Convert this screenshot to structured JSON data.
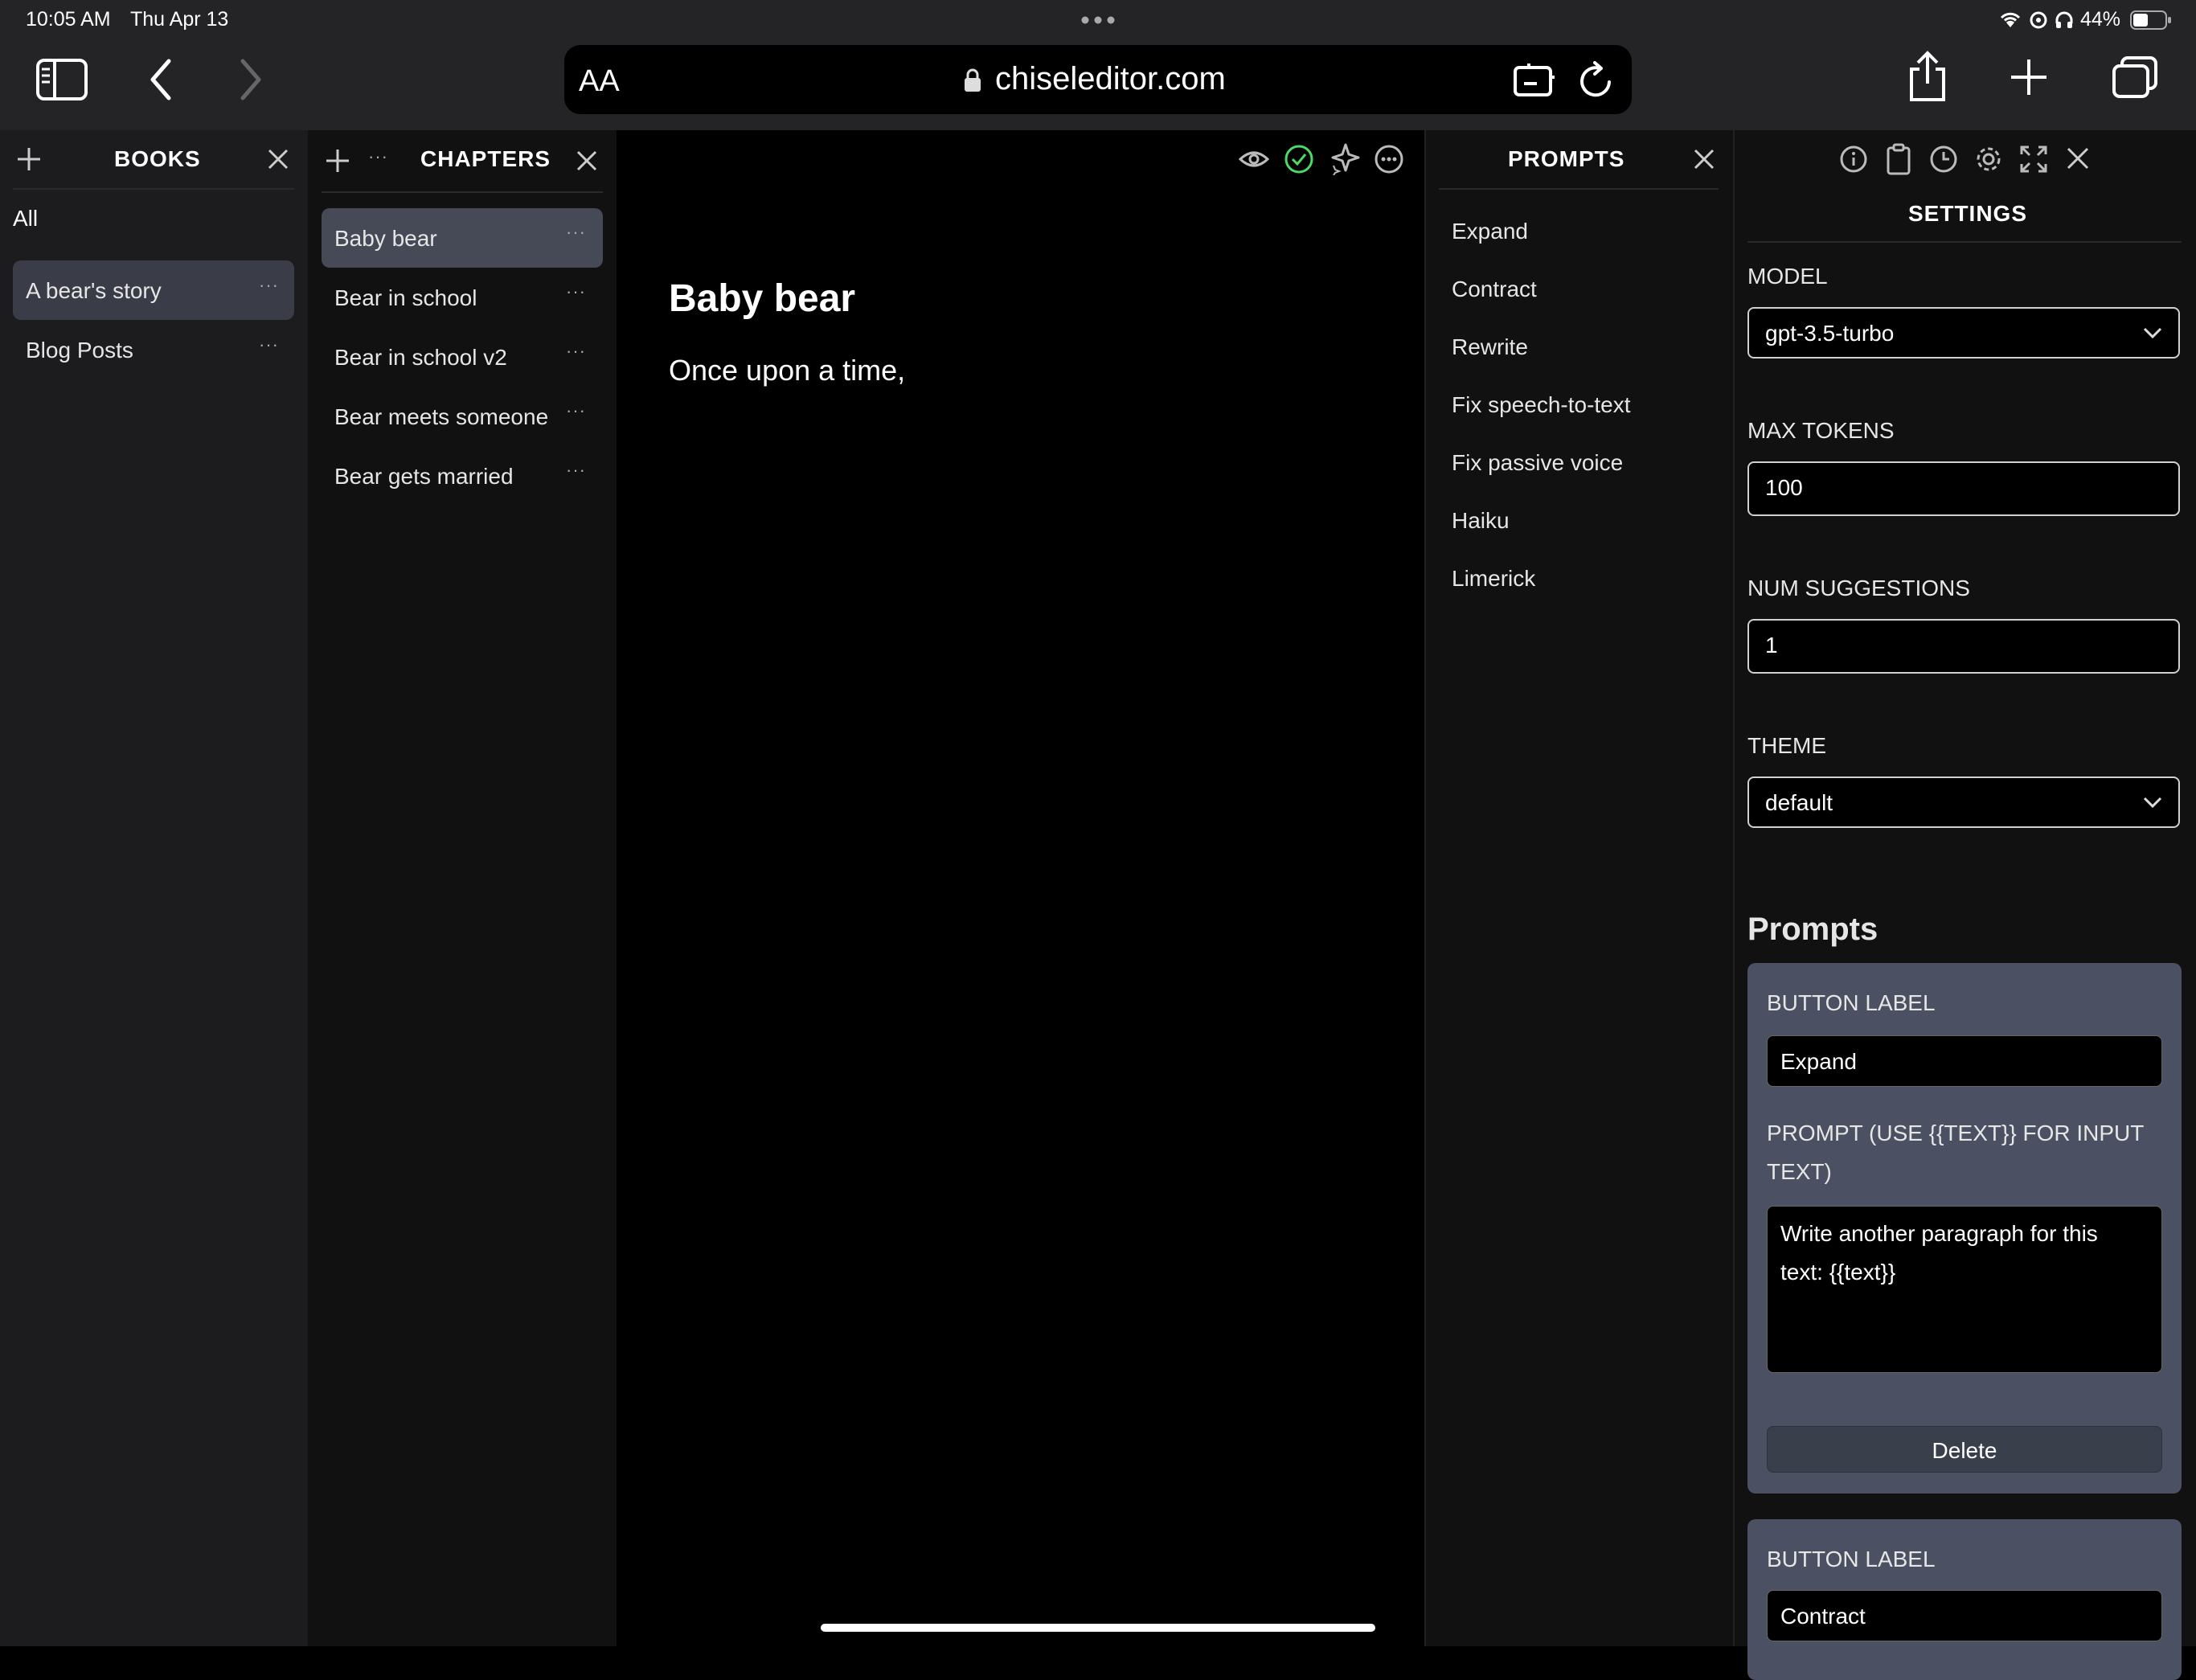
{
  "status": {
    "time": "10:05 AM",
    "date": "Thu Apr 13",
    "battery": "44%"
  },
  "browser": {
    "aa": "AA",
    "url": "chiseleditor.com"
  },
  "books": {
    "title": "BOOKS",
    "all_label": "All",
    "items": [
      {
        "label": "A bear's story",
        "selected": true
      },
      {
        "label": "Blog Posts",
        "selected": false
      }
    ]
  },
  "chapters": {
    "title": "CHAPTERS",
    "items": [
      {
        "label": "Baby bear",
        "selected": true
      },
      {
        "label": "Bear in school"
      },
      {
        "label": "Bear in school v2"
      },
      {
        "label": "Bear meets someone"
      },
      {
        "label": "Bear gets married"
      }
    ]
  },
  "editor": {
    "title": "Baby bear",
    "body": "Once upon a time,"
  },
  "prompts_panel": {
    "title": "PROMPTS",
    "items": [
      "Expand",
      "Contract",
      "Rewrite",
      "Fix speech-to-text",
      "Fix passive voice",
      "Haiku",
      "Limerick"
    ]
  },
  "settings": {
    "title": "SETTINGS",
    "model_label": "MODEL",
    "model_value": "gpt-3.5-turbo",
    "max_tokens_label": "MAX TOKENS",
    "max_tokens_value": "100",
    "num_suggestions_label": "NUM SUGGESTIONS",
    "num_suggestions_value": "1",
    "theme_label": "THEME",
    "theme_value": "default",
    "prompts_heading": "Prompts",
    "prompt_cards": [
      {
        "button_label_title": "BUTTON LABEL",
        "button_label_value": "Expand",
        "prompt_title_line1": "PROMPT (USE {{TEXT}} FOR INPUT",
        "prompt_title_line2": "TEXT)",
        "prompt_line1": "Write another paragraph for this",
        "prompt_line2": "text: {{text}}",
        "delete_label": "Delete"
      },
      {
        "button_label_title": "BUTTON LABEL",
        "button_label_value": "Contract"
      }
    ]
  },
  "colors": {
    "selected_row": "#464a57",
    "card": "#4b5162",
    "check_green": "#4cd964"
  }
}
